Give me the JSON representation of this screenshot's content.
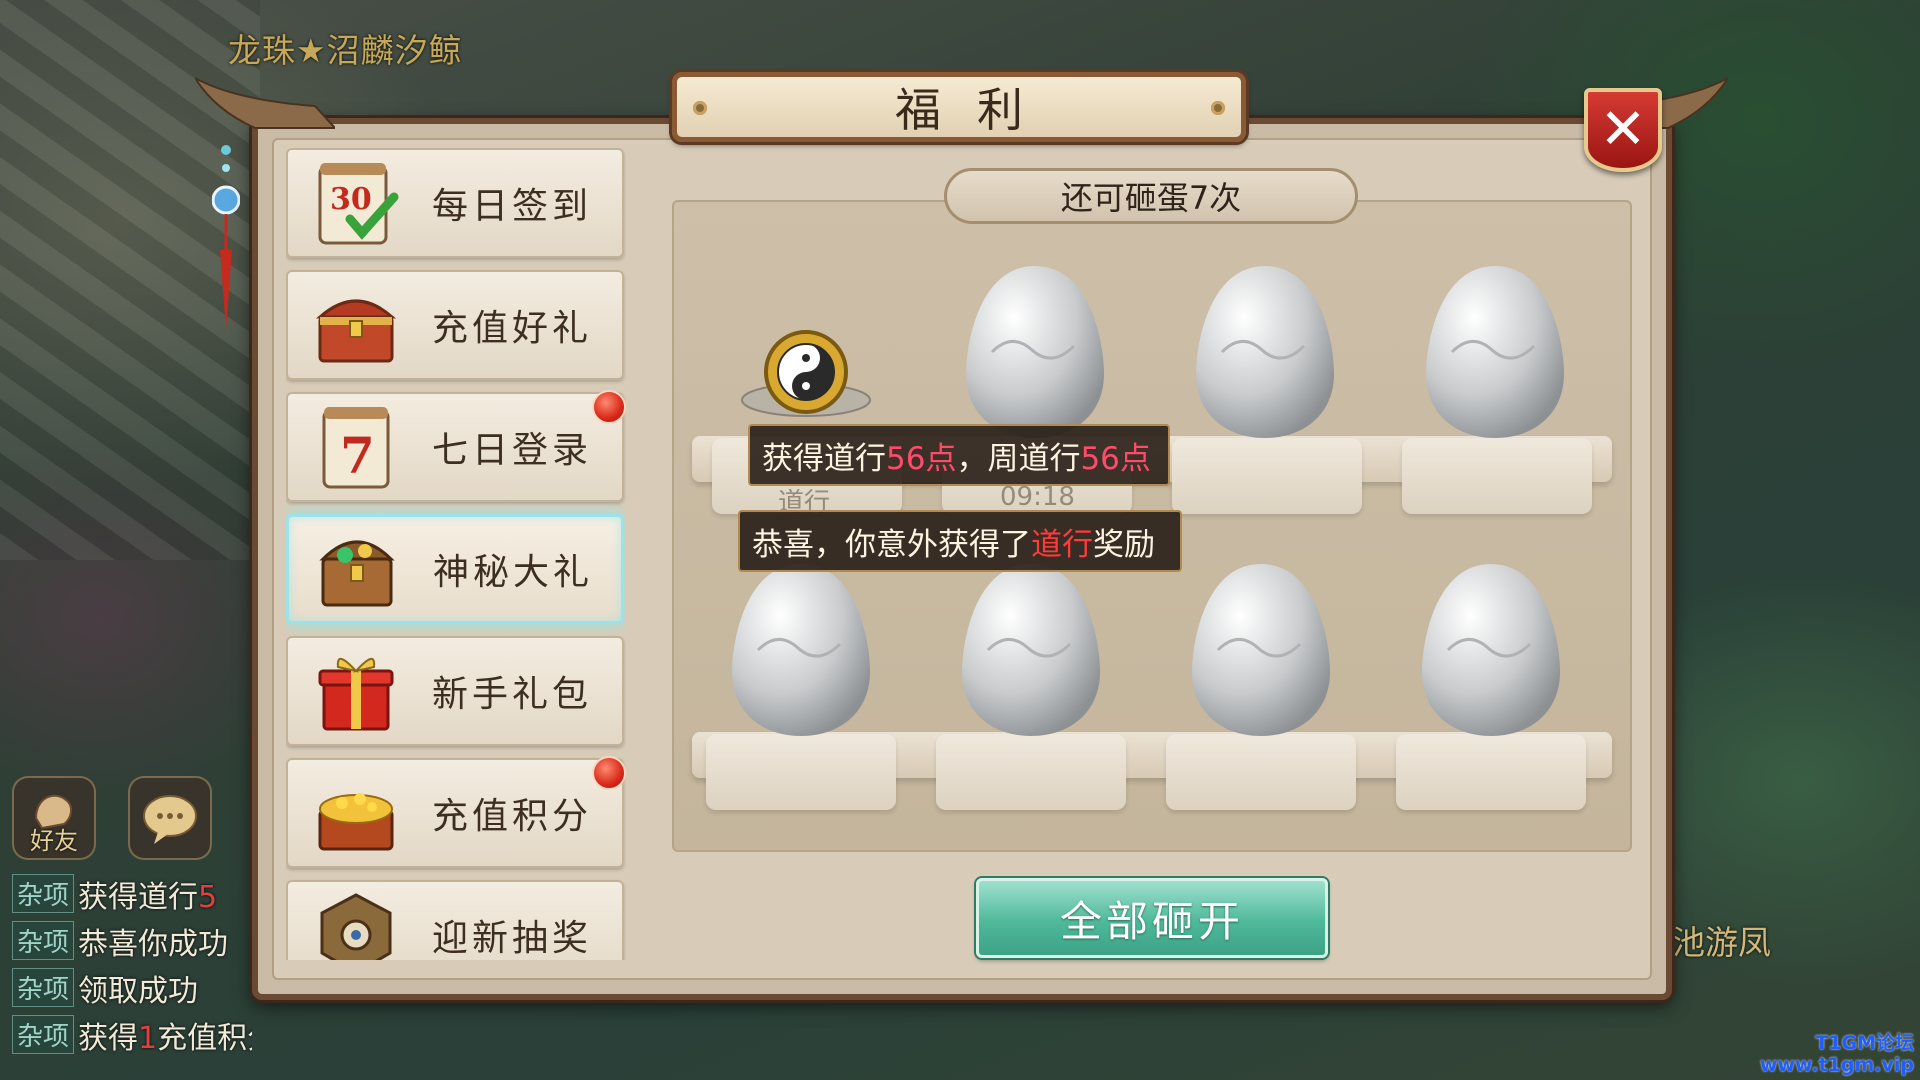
{
  "world": {
    "player_name": "龙珠★沼麟汐鲸",
    "npc_name": "池游凤",
    "watermark_line1": "T1GM论坛",
    "watermark_line2": "www.t1gm.vip",
    "friend_label": "好友",
    "chat_log": [
      {
        "tag": "杂项",
        "text": "获得道行",
        "extra": "5"
      },
      {
        "tag": "杂项",
        "text": "恭喜你成功",
        "extra": ""
      },
      {
        "tag": "杂项",
        "text": "领取成功",
        "extra": ""
      },
      {
        "tag": "杂项",
        "text": "获得",
        "extra": "1",
        "tail": "充值积分"
      }
    ]
  },
  "panel": {
    "title": "福利",
    "close_icon": "close-icon",
    "menu": [
      {
        "label": "每日签到",
        "icon": "calendar-30-icon",
        "badge": false
      },
      {
        "label": "充值好礼",
        "icon": "treasure-chest-icon",
        "badge": false
      },
      {
        "label": "七日登录",
        "icon": "calendar-7-icon",
        "badge": true
      },
      {
        "label": "神秘大礼",
        "icon": "mystery-chest-icon",
        "badge": false,
        "active": true
      },
      {
        "label": "新手礼包",
        "icon": "gift-box-icon",
        "badge": false
      },
      {
        "label": "充值积分",
        "icon": "gold-chest-icon",
        "badge": true
      },
      {
        "label": "迎新抽奖",
        "icon": "lottery-wheel-icon",
        "badge": false
      }
    ],
    "egg_counter": "还可砸蛋7次",
    "toast1": {
      "a": "获得道行",
      "b": "56点",
      "c": "，周道行",
      "d": "56点"
    },
    "toast2": {
      "a": "恭喜，你意外获得了",
      "b": "道行",
      "c": "奖励"
    },
    "faded_label": "道行",
    "faded_time": "09:18",
    "smash_all": "全部砸开",
    "colors": {
      "accent": "#4fb99a",
      "highlight": "#ff4a6a",
      "badge": "#d8291a"
    }
  }
}
